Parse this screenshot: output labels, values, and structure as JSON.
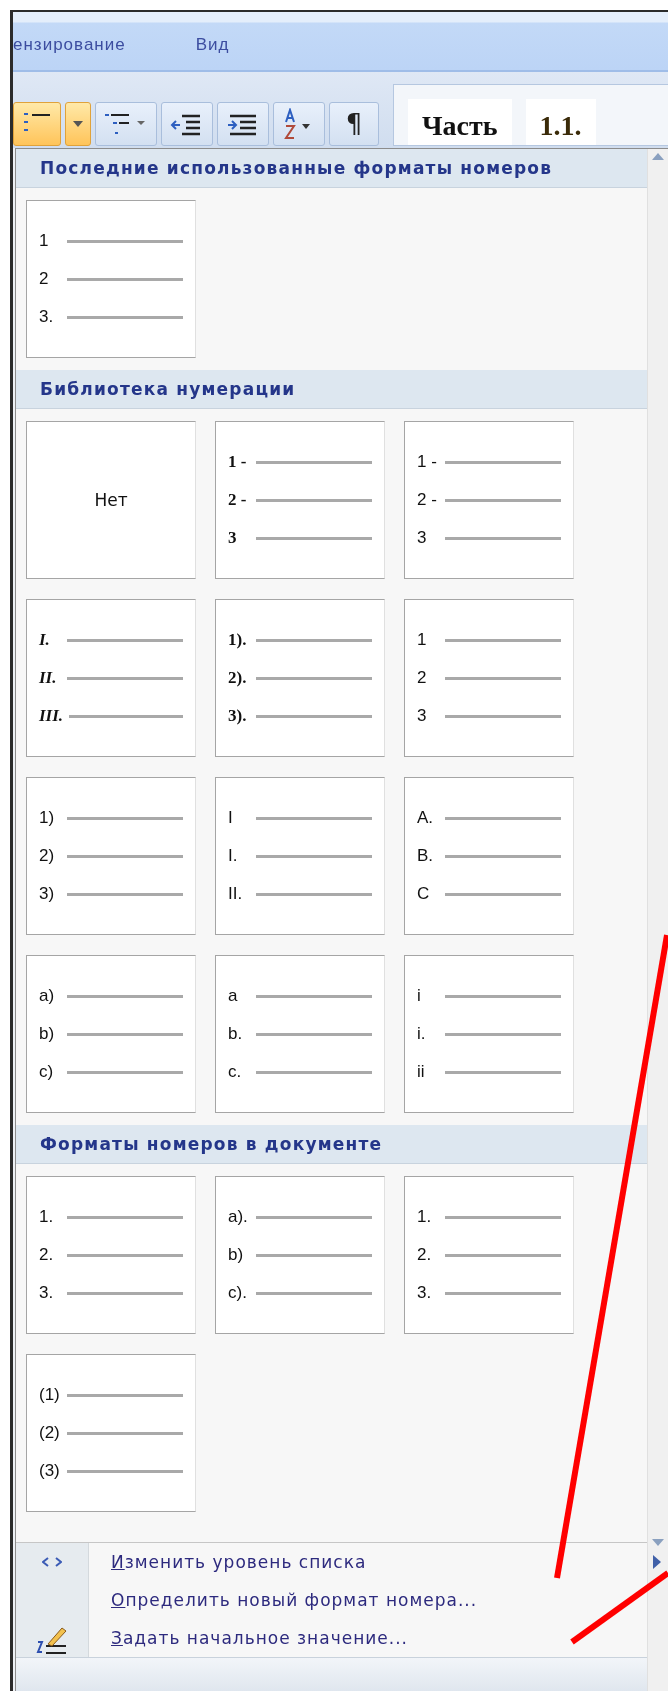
{
  "tabs": [
    {
      "label": "ензирование"
    },
    {
      "label": "Вид"
    }
  ],
  "toolbar": {
    "pilcrow": "¶"
  },
  "styles_gallery": [
    "Часть",
    "1.1."
  ],
  "sections": [
    {
      "title": "Последние использованные форматы номеров",
      "cards": [
        {
          "kind": "sans",
          "items": [
            "1",
            "2",
            "3."
          ]
        }
      ]
    },
    {
      "title": "Библиотека нумерации",
      "cards": [
        {
          "kind": "none",
          "label": "Нет"
        },
        {
          "kind": "serif",
          "items": [
            "1 -",
            "2 -",
            "3"
          ]
        },
        {
          "kind": "sans",
          "items": [
            "1 -",
            "2 -",
            "3"
          ]
        },
        {
          "kind": "italic",
          "items": [
            "I.",
            "II.",
            "III."
          ]
        },
        {
          "kind": "serif",
          "items": [
            "1).",
            "2).",
            "3)."
          ]
        },
        {
          "kind": "sans",
          "items": [
            "1",
            "2",
            "3"
          ]
        },
        {
          "kind": "sans",
          "items": [
            "1)",
            "2)",
            "3)"
          ]
        },
        {
          "kind": "sans",
          "items": [
            "I",
            "I.",
            "II."
          ]
        },
        {
          "kind": "sans",
          "items": [
            "A.",
            "B.",
            "C"
          ]
        },
        {
          "kind": "sans",
          "items": [
            "a)",
            "b)",
            "c)"
          ]
        },
        {
          "kind": "sans",
          "items": [
            "a",
            "b.",
            "c."
          ]
        },
        {
          "kind": "sans",
          "items": [
            "i",
            "i.",
            "ii"
          ]
        }
      ]
    },
    {
      "title": "Форматы номеров в документе",
      "cards": [
        {
          "kind": "sans",
          "items": [
            "1.",
            "2.",
            "3."
          ]
        },
        {
          "kind": "sans",
          "items": [
            "a).",
            "b)",
            "c)."
          ]
        },
        {
          "kind": "sans",
          "items": [
            "1.",
            "2.",
            "3."
          ]
        },
        {
          "kind": "sans",
          "items": [
            "(1)",
            "(2)",
            "(3)"
          ]
        }
      ]
    }
  ],
  "menu": [
    {
      "label": "Изменить уровень списка",
      "submenu": true
    },
    {
      "label": "Определить новый формат номера...",
      "submenu": false
    },
    {
      "label": "Задать начальное значение...",
      "submenu": false
    }
  ]
}
